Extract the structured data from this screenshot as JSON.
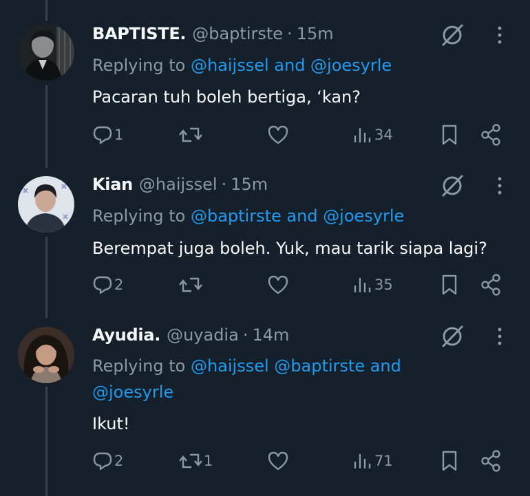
{
  "tweets": [
    {
      "name": "BAPTISTE.",
      "handle": "@baptirste",
      "separator": "·",
      "time": "15m",
      "replying_prefix": "Replying to",
      "replying_line1": [
        {
          "text": "@haijssel and @joesyrle",
          "kind": "mention"
        }
      ],
      "replying_line2": [],
      "text": "Pacaran tuh boleh bertiga, ‘kan?",
      "replies": "1",
      "retweets": "",
      "likes": "",
      "views": "34",
      "avatar_tone": "#262a2c"
    },
    {
      "name": "Kian",
      "handle": "@haijssel",
      "separator": "·",
      "time": "15m",
      "replying_prefix": "Replying to",
      "replying_line1": [
        {
          "text": "@baptirste and @joesyrle",
          "kind": "mention"
        }
      ],
      "replying_line2": [],
      "text": "Berempat juga boleh. Yuk, mau tarik siapa lagi?",
      "replies": "2",
      "retweets": "",
      "likes": "",
      "views": "35",
      "avatar_tone": "#d8dde6"
    },
    {
      "name": "Ayudia.",
      "handle": "@uyadia",
      "separator": "·",
      "time": "14m",
      "replying_prefix": "Replying to",
      "replying_line1": [
        {
          "text": "@haijssel @baptirste and",
          "kind": "mention"
        }
      ],
      "replying_line2": [
        {
          "text": "@joesyrle",
          "kind": "mention"
        }
      ],
      "text": "Ikut!",
      "replies": "2",
      "retweets": "1",
      "likes": "",
      "views": "71",
      "avatar_tone": "#6b5446"
    }
  ],
  "icons": {
    "reply": "reply-icon",
    "retweet": "retweet-icon",
    "like": "heart-icon",
    "views": "views-chart-icon",
    "bookmark": "bookmark-icon",
    "share": "share-icon",
    "grok": "grok-icon",
    "more": "more-icon"
  },
  "colors": {
    "background": "#15202b",
    "text": "#f7f9f9",
    "secondary": "#8b98a5",
    "accent": "#1d9bf0",
    "thread_line": "#38444d"
  }
}
